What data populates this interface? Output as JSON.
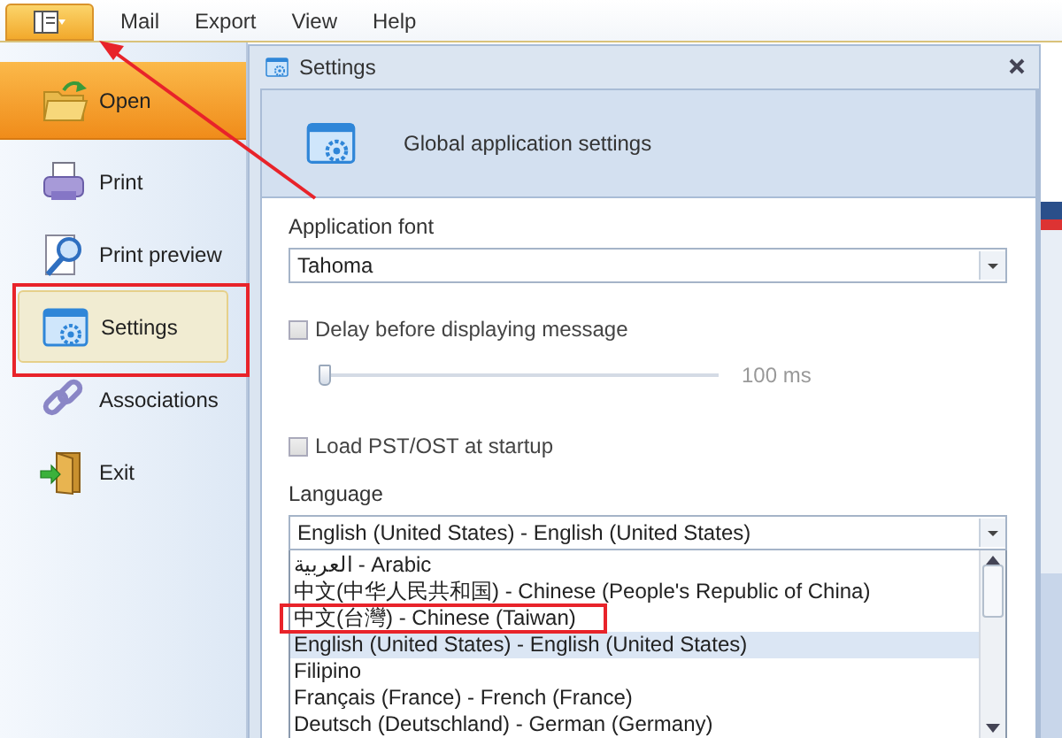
{
  "menu_bar": {
    "items": [
      {
        "label": "Mail"
      },
      {
        "label": "Export"
      },
      {
        "label": "View"
      },
      {
        "label": "Help"
      }
    ]
  },
  "sidebar": {
    "items": [
      {
        "label": "Open",
        "highlighted": true,
        "selected": false
      },
      {
        "label": "Print",
        "highlighted": false,
        "selected": false
      },
      {
        "label": "Print preview",
        "highlighted": false,
        "selected": false
      },
      {
        "label": "Settings",
        "highlighted": false,
        "selected": true
      },
      {
        "label": "Associations",
        "highlighted": false,
        "selected": false
      },
      {
        "label": "Exit",
        "highlighted": false,
        "selected": false
      }
    ]
  },
  "dialog": {
    "title": "Settings",
    "banner": "Global application settings",
    "font_label": "Application font",
    "font_value": "Tahoma",
    "delay_checkbox": {
      "label": "Delay before displaying message",
      "checked": false
    },
    "delay_slider": {
      "level": 0,
      "reading": "100 ms"
    },
    "load_checkbox": {
      "label": "Load PST/OST at startup",
      "checked": false
    },
    "language_label": "Language",
    "language_value": "English (United States) - English (United States)",
    "language_options": [
      {
        "label": "العربية - Arabic",
        "selected": false
      },
      {
        "label": "中文(中华人民共和国) - Chinese (People's Republic of China)",
        "selected": false
      },
      {
        "label": "中文(台灣) - Chinese (Taiwan)",
        "selected": false
      },
      {
        "label": "English (United States) - English (United States)",
        "selected": true
      },
      {
        "label": "Filipino",
        "selected": false
      },
      {
        "label": "Français (France) - French (France)",
        "selected": false
      },
      {
        "label": "Deutsch (Deutschland) - German (Germany)",
        "selected": false
      }
    ]
  }
}
